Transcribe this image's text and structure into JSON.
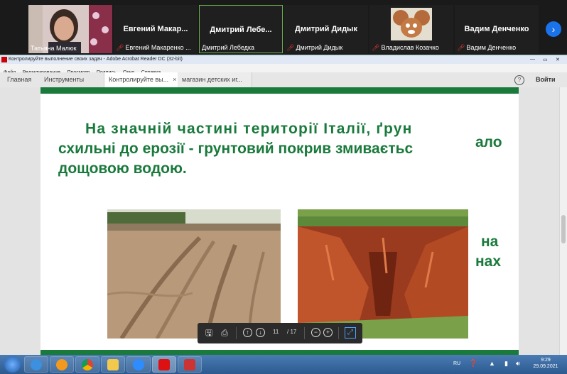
{
  "zoom": {
    "participants": [
      {
        "big": "",
        "small": "Татьяна Малюк",
        "muted": false
      },
      {
        "big": "Евгений  Макар...",
        "small": "Евгений Макаренко ...",
        "muted": true
      },
      {
        "big": "Дмитрий  Лебе...",
        "small": "Дмитрий Лебедка",
        "muted": false
      },
      {
        "big": "Дмитрий Дидык",
        "small": "Дмитрий Дидык",
        "muted": true
      },
      {
        "big": "",
        "small": "Владислав Козачко",
        "muted": true
      },
      {
        "big": "Вадим Денченко",
        "small": "Вадим Денченко",
        "muted": true
      }
    ],
    "next_icon": "chevron-right-icon"
  },
  "acrobat": {
    "title": "Контролируйте выполнение своих задач - Adobe Acrobat Reader DC (32-bit)",
    "menu": [
      "Файл",
      "Редактирование",
      "Просмотр",
      "Подпись",
      "Окно",
      "Справка"
    ],
    "tabs": {
      "home": "Главная",
      "tools": "Инструменты",
      "doc1": "Контролируйте вы...",
      "doc2": "магазин детских иг..."
    },
    "signin": "Войти",
    "help": "?"
  },
  "slide": {
    "line1": "На  значній  частині  території  Італії,  ґрун",
    "line2": "схильні до ерозії - грунтовий покрив змиваєтьс",
    "line3": "дощовою водою.",
    "frag_right1": "ало",
    "frag_right2": "на",
    "frag_right3": "нах"
  },
  "toolbar": {
    "page_current": "11",
    "page_total": "/ 17"
  },
  "taskbar": {
    "lang": "RU",
    "time": "9:29",
    "date": "29.09.2021"
  },
  "colors": {
    "slide_green": "#1a7a3c",
    "zoom_bg": "#1a1a1a",
    "active_border": "#6ab04c"
  }
}
